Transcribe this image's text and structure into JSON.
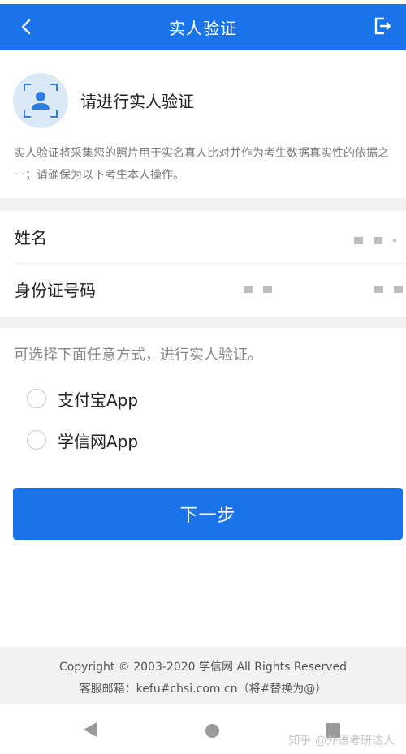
{
  "header": {
    "title": "实人验证",
    "back_icon": "chevron-left-icon",
    "exit_icon": "logout-icon",
    "bg_color": "#1a73e8"
  },
  "intro": {
    "icon": "face-verify-icon",
    "title": "请进行实人验证",
    "description": "实人验证将采集您的照片用于实名真人比对并作为考生数据真实性的依据之一；请确保为以下考生本人操作。"
  },
  "info": {
    "name_label": "姓名",
    "id_label": "身份证号码"
  },
  "methods": {
    "tip": "可选择下面任意方式，进行实人验证。",
    "options": [
      {
        "label": "支付宝App",
        "selected": false
      },
      {
        "label": "学信网App",
        "selected": false
      }
    ]
  },
  "next_button": {
    "label": "下一步"
  },
  "footer": {
    "copyright": "Copyright © 2003-2020 学信网 All Rights Reserved",
    "contact": "客服邮箱：kefu#chsi.com.cn（将#替换为@）"
  },
  "watermark": "知乎 @外语考研达人"
}
